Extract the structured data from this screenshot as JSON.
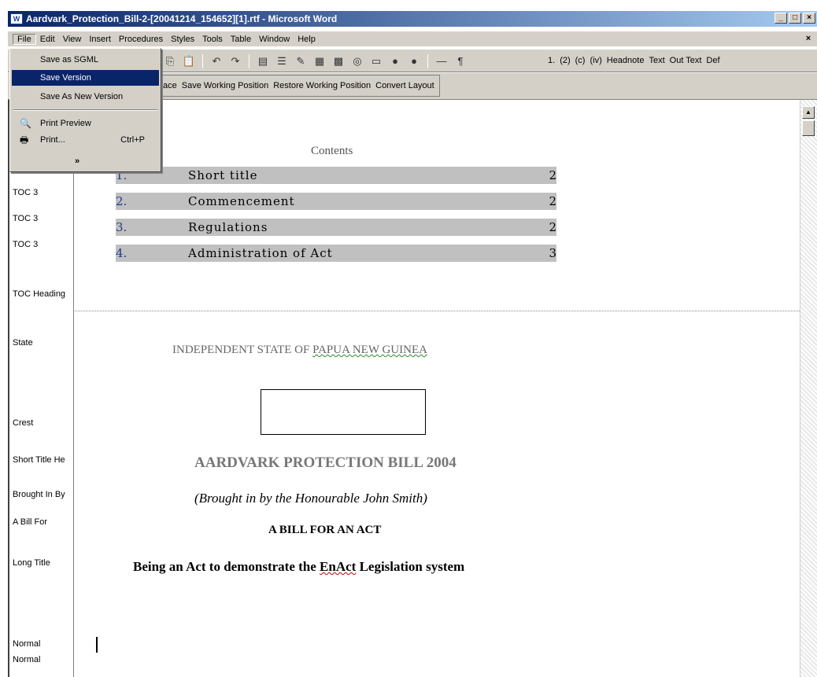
{
  "window": {
    "title": "Aardvark_Protection_Bill-2-[20041214_154652][1].rtf - Microsoft Word",
    "buttons": [
      "_",
      "□",
      "×"
    ]
  },
  "menubar": {
    "items": [
      "File",
      "Edit",
      "View",
      "Insert",
      "Procedures",
      "Styles",
      "Tools",
      "Table",
      "Window",
      "Help"
    ],
    "close": "×"
  },
  "toolbar": {
    "levels": [
      "1.",
      "(2)",
      "(c)",
      "(iv)",
      "Headnote",
      "Text",
      "Out Text",
      "Def"
    ],
    "pilcrow": "¶",
    "dash": "—",
    "custom_buttons": [
      "ace",
      "Save Working Position",
      "Restore Working Position",
      "Convert Layout"
    ]
  },
  "file_menu": {
    "items": [
      {
        "label": "Save as SGML",
        "selected": false
      },
      {
        "label": "Save Version",
        "selected": true
      },
      {
        "label": "Save As New Version",
        "selected": false
      },
      {
        "label": "Print Preview",
        "selected": false,
        "icon": "print-preview-icon"
      },
      {
        "label": "Print...",
        "shortcut": "Ctrl+P",
        "selected": false,
        "icon": "printer-icon"
      }
    ],
    "more": "»"
  },
  "style_pane": {
    "labels": [
      "TOC 3",
      "TOC 3",
      "TOC 3",
      "TOC Heading",
      "State",
      "Crest",
      "Short Title He",
      "Brought In By",
      "A Bill For",
      "Long Title",
      "Normal",
      "Normal"
    ]
  },
  "document": {
    "contents_title": "Contents",
    "toc": [
      {
        "num": "1.",
        "title": "Short title",
        "page": "2"
      },
      {
        "num": "2.",
        "title": "Commencement",
        "page": "2"
      },
      {
        "num": "3.",
        "title": "Regulations",
        "page": "2"
      },
      {
        "num": "4.",
        "title": "Administration of Act",
        "page": "3"
      }
    ],
    "state_prefix": "INDEPENDENT STATE OF ",
    "state_squiggle": "PAPUA NEW GUINEA",
    "short_title": "AARDVARK PROTECTION BILL 2004",
    "brought_in": "(Brought in by the Honourable John Smith)",
    "a_bill_for": "A BILL FOR AN ACT",
    "long_title_a": "Being an Act to demonstrate the ",
    "long_title_b": "EnAct",
    "long_title_c": " Legislation system"
  },
  "colors": {
    "title_bar": "#0a246a",
    "menu_highlight": "#0a246a",
    "toc_band": "#c0c0c0",
    "toc_number": "#1f3a8a"
  }
}
